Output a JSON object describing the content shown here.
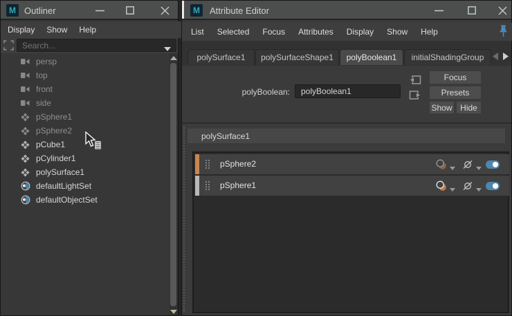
{
  "maya_logo_letter": "M",
  "palette": {
    "accent_blue": "#4d87ae",
    "orange_bar": "#c9854d",
    "gray_bar": "#b8b8b8",
    "titlebar_bg": "#4b4e4c",
    "panel_bg": "#373737"
  },
  "outliner": {
    "title": "Outliner",
    "menus": [
      "Display",
      "Show",
      "Help"
    ],
    "search_placeholder": "Search...",
    "items": [
      {
        "label": "persp",
        "icon": "camera-icon",
        "dim": true
      },
      {
        "label": "top",
        "icon": "camera-icon",
        "dim": true
      },
      {
        "label": "front",
        "icon": "camera-icon",
        "dim": true
      },
      {
        "label": "side",
        "icon": "camera-icon",
        "dim": true
      },
      {
        "label": "pSphere1",
        "icon": "mesh-icon",
        "dim": true
      },
      {
        "label": "pSphere2",
        "icon": "mesh-icon",
        "dim": true
      },
      {
        "label": "pCube1",
        "icon": "mesh-icon",
        "dim": false
      },
      {
        "label": "pCylinder1",
        "icon": "mesh-icon",
        "dim": false
      },
      {
        "label": "polySurface1",
        "icon": "mesh-icon",
        "dim": false
      },
      {
        "label": "defaultLightSet",
        "icon": "set-icon",
        "dim": false
      },
      {
        "label": "defaultObjectSet",
        "icon": "set-icon",
        "dim": false
      }
    ]
  },
  "attribute_editor": {
    "title": "Attribute Editor",
    "menus": [
      "List",
      "Selected",
      "Focus",
      "Attributes",
      "Display",
      "Show",
      "Help"
    ],
    "tabs": [
      {
        "label": "polySurface1",
        "active": false
      },
      {
        "label": "polySurfaceShape1",
        "active": false
      },
      {
        "label": "polyBoolean1",
        "active": true
      },
      {
        "label": "initialShadingGroup",
        "active": false
      }
    ],
    "node": {
      "type_label": "polyBoolean:",
      "name_value": "polyBoolean1"
    },
    "buttons": {
      "focus": "Focus",
      "presets": "Presets",
      "show": "Show",
      "hide": "Hide"
    },
    "section_header": "polySurface1",
    "input_rows": [
      {
        "label": "pSphere2",
        "bar_color": "#c9854d",
        "toggle_on": true
      },
      {
        "label": "pSphere1",
        "bar_color": "#b8b8b8",
        "toggle_on": true
      }
    ]
  }
}
